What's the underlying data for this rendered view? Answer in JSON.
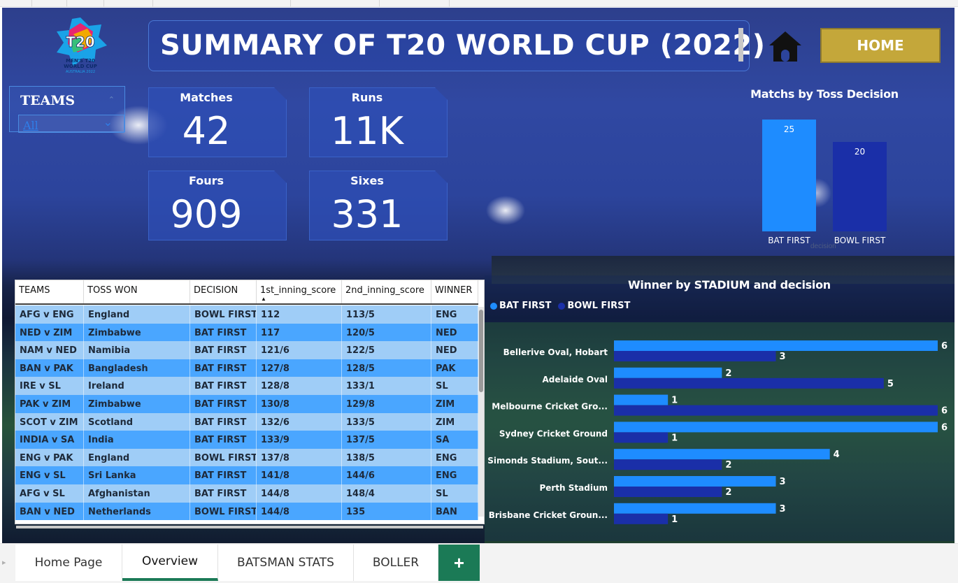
{
  "header": {
    "title": "SUMMARY OF T20 WORLD CUP (2022)",
    "home_label": "HOME",
    "logo_text": "ICC MEN'S T20 WORLD CUP AUSTRALIA 2022"
  },
  "slicer": {
    "label": "TEAMS",
    "value": "All"
  },
  "kpis": [
    {
      "label": "Matches",
      "value": "42"
    },
    {
      "label": "Runs",
      "value": "11K"
    },
    {
      "label": "Fours",
      "value": "909"
    },
    {
      "label": "Sixes",
      "value": "331"
    }
  ],
  "toss_chart": {
    "title": "Matchs by Toss Decision",
    "axis_label": "decision",
    "chart_data": {
      "type": "bar",
      "categories": [
        "BAT FIRST",
        "BOWL FIRST"
      ],
      "values": [
        25,
        20
      ],
      "colors": [
        "#1e8cff",
        "#1a2fa8"
      ]
    }
  },
  "match_table": {
    "columns": [
      "TEAMS",
      "TOSS WON",
      "DECISION",
      "1st_inning_score",
      "2nd_inning_score",
      "WINNER"
    ],
    "sorted_column": "1st_inning_score",
    "rows": [
      [
        "AFG v ENG",
        "England",
        "BOWL FIRST",
        "112",
        "113/5",
        "ENG"
      ],
      [
        "NED v ZIM",
        "Zimbabwe",
        "BAT FIRST",
        "117",
        "120/5",
        "NED"
      ],
      [
        "NAM v NED",
        "Namibia",
        "BAT FIRST",
        "121/6",
        "122/5",
        "NED"
      ],
      [
        "BAN v PAK",
        "Bangladesh",
        "BAT FIRST",
        "127/8",
        "128/5",
        "PAK"
      ],
      [
        "IRE v SL",
        "Ireland",
        "BAT FIRST",
        "128/8",
        "133/1",
        "SL"
      ],
      [
        "PAK v ZIM",
        "Zimbabwe",
        "BAT FIRST",
        "130/8",
        "129/8",
        "ZIM"
      ],
      [
        "SCOT v ZIM",
        "Scotland",
        "BAT FIRST",
        "132/6",
        "133/5",
        "ZIM"
      ],
      [
        "INDIA v SA",
        "India",
        "BAT FIRST",
        "133/9",
        "137/5",
        "SA"
      ],
      [
        "ENG v PAK",
        "England",
        "BOWL FIRST",
        "137/8",
        "138/5",
        "ENG"
      ],
      [
        "ENG v SL",
        "Sri Lanka",
        "BAT FIRST",
        "141/8",
        "144/6",
        "ENG"
      ],
      [
        "AFG v SL",
        "Afghanistan",
        "BAT FIRST",
        "144/8",
        "148/4",
        "SL"
      ],
      [
        "BAN v NED",
        "Netherlands",
        "BOWL FIRST",
        "144/8",
        "135",
        "BAN"
      ]
    ],
    "row_colors": [
      "#9fcdf7",
      "#4aa6ff"
    ]
  },
  "stadium_chart": {
    "title": "Winner by STADIUM and decision",
    "legend": [
      {
        "label": "BAT FIRST",
        "color": "#1e8cff"
      },
      {
        "label": "BOWL FIRST",
        "color": "#1a2fa8"
      }
    ],
    "chart_data": {
      "type": "bar",
      "orientation": "horizontal",
      "categories": [
        "Bellerive Oval, Hobart",
        "Adelaide Oval",
        "Melbourne Cricket Gro...",
        "Sydney Cricket Ground",
        "Simonds Stadium, Sout...",
        "Perth Stadium",
        "Brisbane Cricket Groun..."
      ],
      "series": [
        {
          "name": "BAT FIRST",
          "values": [
            6,
            2,
            1,
            6,
            4,
            3,
            3
          ]
        },
        {
          "name": "BOWL FIRST",
          "values": [
            3,
            5,
            6,
            1,
            2,
            2,
            1
          ]
        }
      ],
      "xlim": [
        0,
        6
      ]
    }
  },
  "tabs": {
    "items": [
      {
        "label": "Home Page",
        "active": false
      },
      {
        "label": "Overview",
        "active": true
      },
      {
        "label": "BATSMAN STATS",
        "active": false
      },
      {
        "label": "BOLLER",
        "active": false
      }
    ],
    "add_label": "+"
  }
}
